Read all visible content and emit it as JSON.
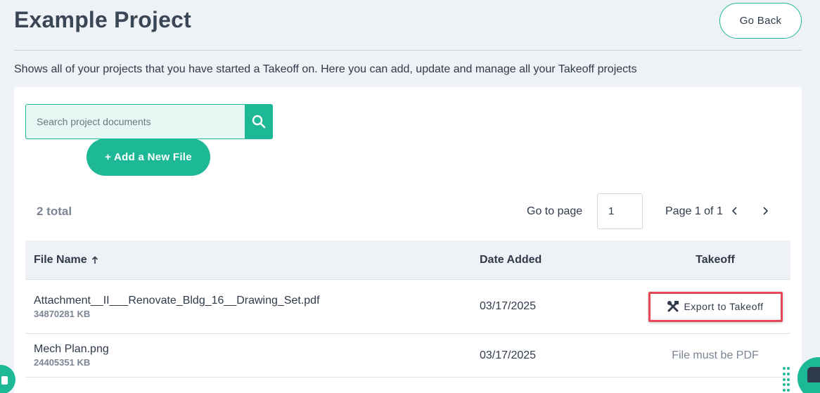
{
  "header": {
    "title": "Example Project",
    "go_back_label": "Go Back"
  },
  "description": "Shows all of your projects that you have started a Takeoff on. Here you can add, update and manage all your Takeoff projects",
  "search": {
    "placeholder": "Search project documents",
    "value": ""
  },
  "add_file_label": "+ Add a New File",
  "pagination": {
    "total_label": "2 total",
    "goto_label": "Go to page",
    "current_page": "1",
    "page_of_label": "Page 1 of 1"
  },
  "table": {
    "headers": {
      "file_name": "File Name",
      "date_added": "Date Added",
      "takeoff": "Takeoff"
    },
    "sort_icon": "arrow-up-icon",
    "rows": [
      {
        "file_name": "Attachment__II___Renovate_Bldg_16__Drawing_Set.pdf",
        "size": "34870281 KB",
        "date_added": "03/17/2025",
        "takeoff": "Export to Takeoff"
      },
      {
        "file_name": "Mech Plan.png",
        "size": "24405351 KB",
        "date_added": "03/17/2025",
        "takeoff": "File must be PDF"
      }
    ]
  },
  "colors": {
    "accent": "#1db896",
    "highlight": "#e74855",
    "background": "#eef1f5"
  }
}
